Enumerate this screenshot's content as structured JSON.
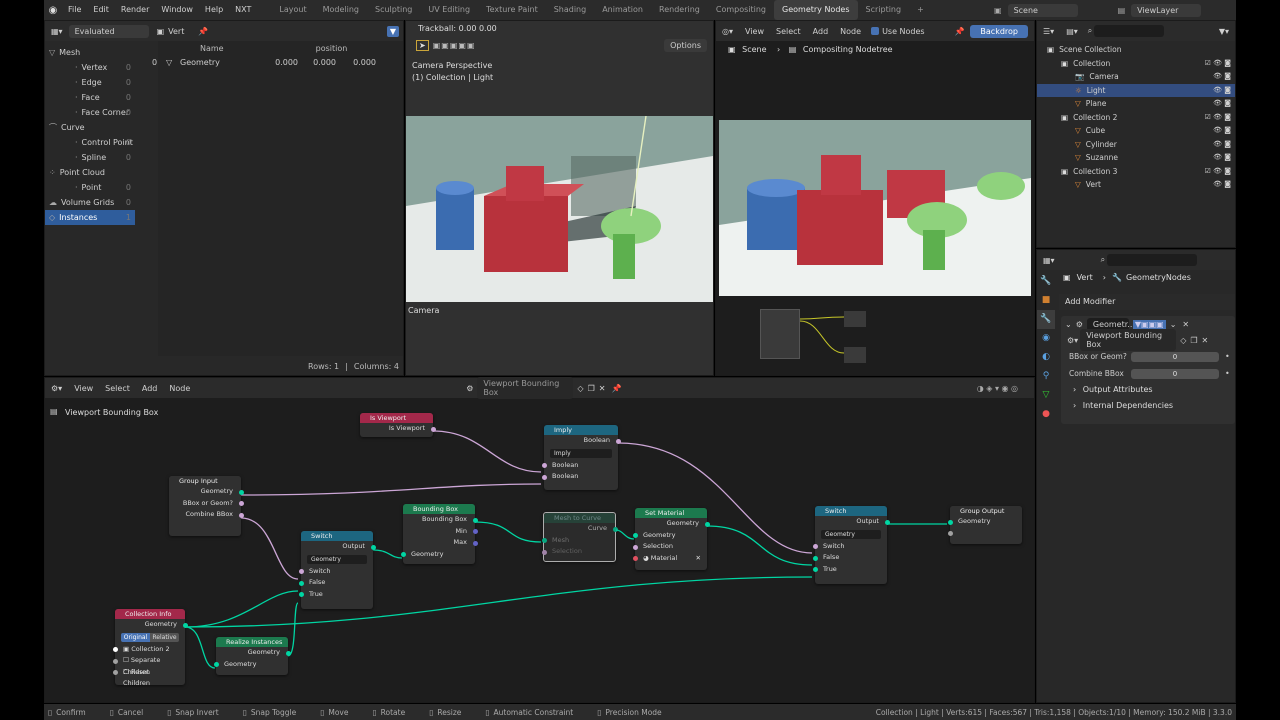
{
  "top_menu": [
    "File",
    "Edit",
    "Render",
    "Window",
    "Help",
    "NXT"
  ],
  "workspaces": [
    "Layout",
    "Modeling",
    "Sculpting",
    "UV Editing",
    "Texture Paint",
    "Shading",
    "Animation",
    "Rendering",
    "Compositing",
    "Geometry Nodes",
    "Scripting",
    "+"
  ],
  "active_workspace": "Geometry Nodes",
  "scene_name": "Scene",
  "view_layer": "ViewLayer",
  "spreadsheet": {
    "mode": "Evaluated",
    "object": "Vert",
    "tree": [
      {
        "label": "Mesh",
        "count": ""
      },
      {
        "label": "Vertex",
        "count": "0"
      },
      {
        "label": "Edge",
        "count": "0"
      },
      {
        "label": "Face",
        "count": "0"
      },
      {
        "label": "Face Corner",
        "count": "0"
      },
      {
        "label": "Curve",
        "count": ""
      },
      {
        "label": "Control Point",
        "count": "0"
      },
      {
        "label": "Spline",
        "count": "0"
      },
      {
        "label": "Point Cloud",
        "count": ""
      },
      {
        "label": "Point",
        "count": "0"
      },
      {
        "label": "Volume Grids",
        "count": "0"
      },
      {
        "label": "Instances",
        "count": "1"
      }
    ],
    "col_name": "Name",
    "col_position": "position",
    "row": {
      "index": "0",
      "name": "Geometry",
      "x": "0.000",
      "y": "0.000",
      "z": "0.000"
    },
    "footer_rows": "Rows: 1",
    "footer_sep": "|",
    "footer_cols": "Columns: 4"
  },
  "viewport": {
    "header": "Trackball: 0.00 0.00",
    "options": "Options",
    "info1": "Camera Perspective",
    "info2": "(1) Collection | Light",
    "label": "Camera"
  },
  "compositor": {
    "view": "View",
    "select": "Select",
    "add": "Add",
    "node": "Node",
    "use_nodes": "Use Nodes",
    "backdrop": "Backdrop",
    "breadcrumb_scene": "Scene",
    "breadcrumb_tree": "Compositing Nodetree"
  },
  "outliner": {
    "items": [
      {
        "label": "Scene Collection",
        "indent": 0,
        "color": "#ccc"
      },
      {
        "label": "Collection",
        "indent": 1,
        "color": "#ccc"
      },
      {
        "label": "Camera",
        "indent": 2,
        "color": "#ccc"
      },
      {
        "label": "Light",
        "indent": 2,
        "color": "#ccc"
      },
      {
        "label": "Plane",
        "indent": 2,
        "color": "#ccc"
      },
      {
        "label": "Collection 2",
        "indent": 1,
        "color": "#ccc"
      },
      {
        "label": "Cube",
        "indent": 2,
        "color": "#ccc"
      },
      {
        "label": "Cylinder",
        "indent": 2,
        "color": "#ccc"
      },
      {
        "label": "Suzanne",
        "indent": 2,
        "color": "#ccc"
      },
      {
        "label": "Collection 3",
        "indent": 1,
        "color": "#ccc"
      },
      {
        "label": "Vert",
        "indent": 2,
        "color": "#ccc"
      }
    ]
  },
  "properties": {
    "object": "Vert",
    "modifier_tree": "GeometryNodes",
    "add_modifier": "Add Modifier",
    "modifier_name": "Geometr..",
    "node_group": "Viewport Bounding Box",
    "inputs": [
      {
        "label": "BBox or Geom?",
        "value": "0"
      },
      {
        "label": "Combine BBox",
        "value": "0"
      }
    ],
    "output_attributes": "Output Attributes",
    "internal_dependencies": "Internal Dependencies"
  },
  "node_editor": {
    "view": "View",
    "select": "Select",
    "add": "Add",
    "node": "Node",
    "group_name": "Viewport Bounding Box",
    "breadcrumb": "Viewport Bounding Box"
  },
  "nodes": {
    "is_viewport": {
      "title": "Is Viewport",
      "out": "Is Viewport"
    },
    "imply": {
      "title": "Imply",
      "out": "Boolean",
      "mode": "Imply",
      "in1": "Boolean",
      "in2": "Boolean"
    },
    "group_input": {
      "title": "Group Input",
      "o1": "Geometry",
      "o2": "BBox or Geom?",
      "o3": "Combine BBox"
    },
    "switch1": {
      "title": "Switch",
      "out": "Output",
      "type": "Geometry",
      "i1": "Switch",
      "i2": "False",
      "i3": "True"
    },
    "bounding_box": {
      "title": "Bounding Box",
      "o1": "Bounding Box",
      "o2": "Min",
      "o3": "Max",
      "in": "Geometry"
    },
    "mesh_to_curve": {
      "title": "Mesh to Curve",
      "out": "Curve",
      "i1": "Mesh",
      "i2": "Selection"
    },
    "set_material": {
      "title": "Set Material",
      "out": "Geometry",
      "i1": "Geometry",
      "i2": "Selection",
      "i3": "Material"
    },
    "switch2": {
      "title": "Switch",
      "out": "Output",
      "type": "Geometry",
      "i1": "Switch",
      "i2": "False",
      "i3": "True"
    },
    "group_output": {
      "title": "Group Output",
      "in": "Geometry"
    },
    "collection_info": {
      "title": "Collection Info",
      "out": "Geometry",
      "btn1": "Original",
      "btn2": "Relative",
      "collection": "Collection 2",
      "o1": "Separate Children",
      "o2": "Reset Children"
    },
    "realize": {
      "title": "Realize Instances",
      "out": "Geometry",
      "in": "Geometry"
    }
  },
  "status_bar": {
    "left": [
      "Confirm",
      "Cancel",
      "Snap Invert",
      "Snap Toggle",
      "Move",
      "Rotate",
      "Resize",
      "Automatic Constraint",
      "Precision Mode"
    ],
    "right": "Collection | Light | Verts:615 | Faces:567 | Tris:1,158 | Objects:1/10 | Memory: 150.2 MiB | 3.3.0"
  },
  "colors": {
    "accent": "#4772b3",
    "geometry_socket": "#00d6a3",
    "boolean_socket": "#cca6d6"
  }
}
